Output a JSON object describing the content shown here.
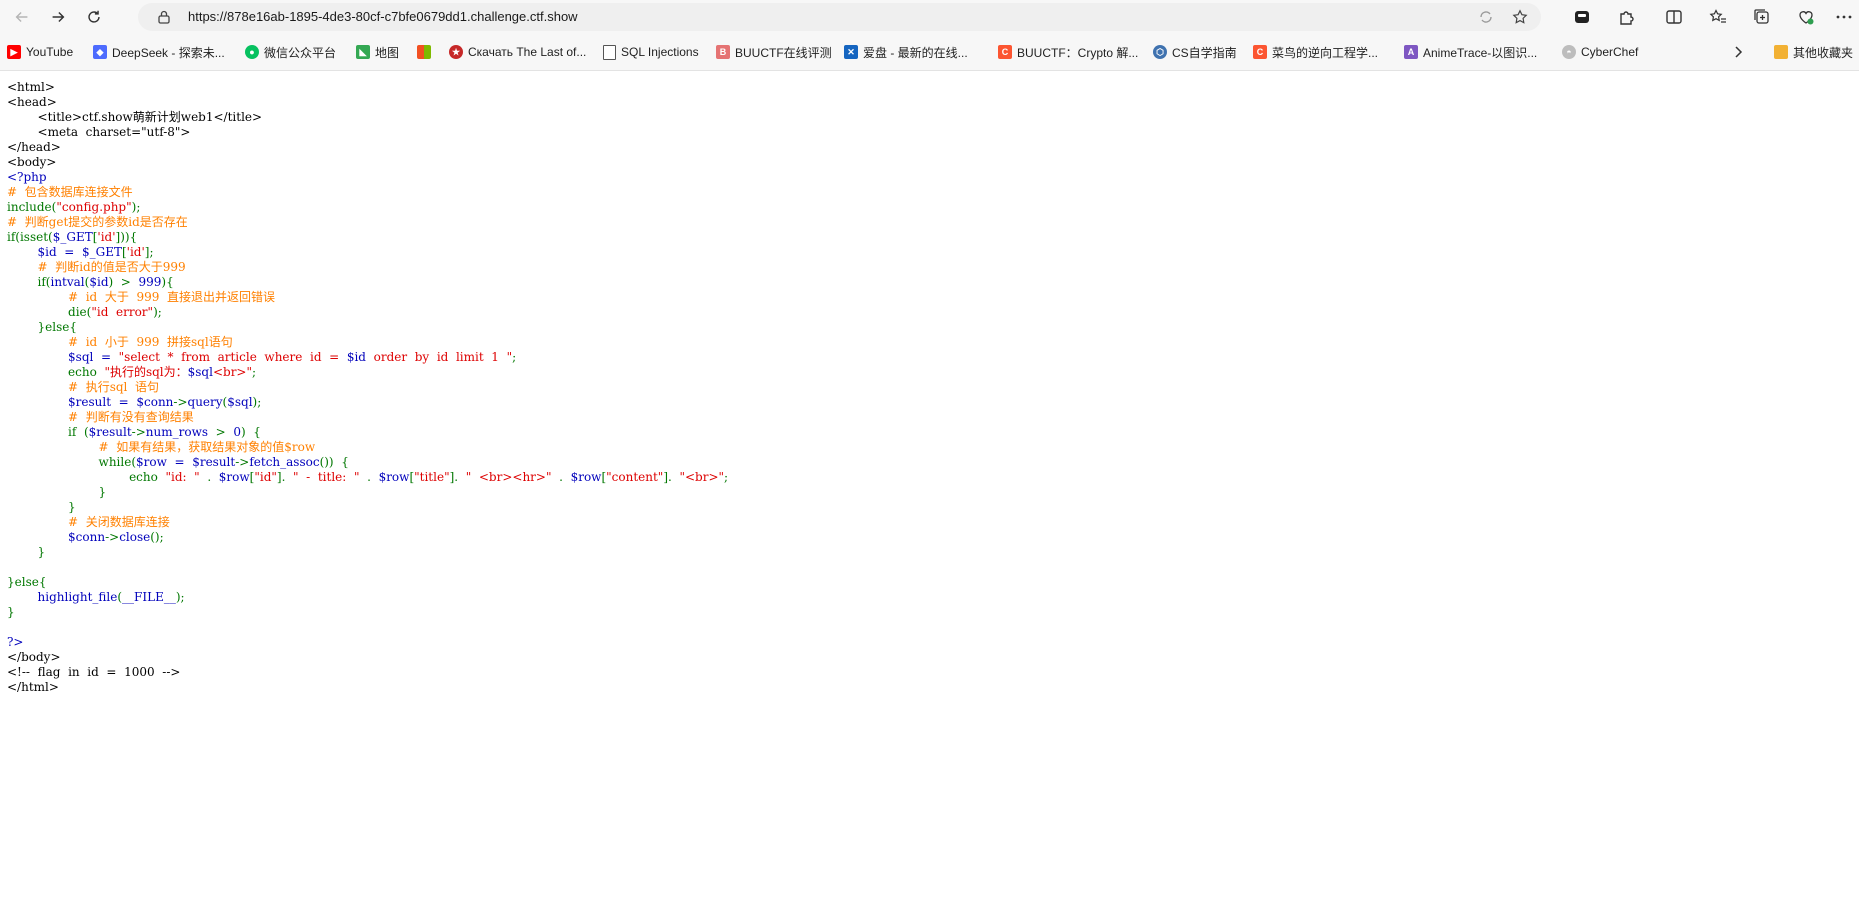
{
  "browser": {
    "url": "https://878e16ab-1895-4de3-80cf-c7bfe0679dd1.challenge.ctf.show",
    "bookmarks": [
      {
        "label": "YouTube",
        "icon": "youtube-icon",
        "color": "#ff0000"
      },
      {
        "label": "DeepSeek - 探索未...",
        "icon": "deepseek-icon",
        "color": "#4d6bfe"
      },
      {
        "label": "微信公众平台",
        "icon": "wechat-icon",
        "color": "#07c160"
      },
      {
        "label": "地图",
        "icon": "map-icon",
        "color": "#34a853"
      },
      {
        "label": "",
        "icon": "microsoft-icon",
        "color": "#f25022"
      },
      {
        "label": "Скачать The Last of...",
        "icon": "site-icon",
        "color": "#c62828"
      },
      {
        "label": "SQL Injections",
        "icon": "page-icon",
        "color": "#555555"
      },
      {
        "label": "BUUCTF在线评测",
        "icon": "buuctf-icon",
        "color": "#e57373"
      },
      {
        "label": "爱盘 - 最新的在线...",
        "icon": "aipan-icon",
        "color": "#1565c0"
      },
      {
        "label": "BUUCTF：Crypto 解...",
        "icon": "csdn-icon",
        "color": "#fc5531"
      },
      {
        "label": "CS自学指南",
        "icon": "cs-icon",
        "color": "#3f72af"
      },
      {
        "label": "菜鸟的逆向工程学...",
        "icon": "csdn-icon",
        "color": "#fc5531"
      },
      {
        "label": "AnimeTrace-以图识...",
        "icon": "animetrace-icon",
        "color": "#7e57c2"
      },
      {
        "label": "CyberChef",
        "icon": "cyberchef-icon",
        "color": "#9e9e9e"
      }
    ],
    "other_bookmarks_label": "其他收藏夹"
  },
  "source_lines": [
    [
      {
        "t": "<html>",
        "c": "html"
      }
    ],
    [
      {
        "t": "<head>",
        "c": "html"
      }
    ],
    [
      {
        "t": "        <title>ctf.show萌新计划web1</title>",
        "c": "html"
      }
    ],
    [
      {
        "t": "        <meta  charset=\"utf-8\">",
        "c": "html"
      }
    ],
    [
      {
        "t": "</head>",
        "c": "html"
      }
    ],
    [
      {
        "t": "<body>",
        "c": "html"
      }
    ],
    [
      {
        "t": "<?php",
        "c": "default"
      }
    ],
    [
      {
        "t": "#  包含数据库连接文件",
        "c": "comment"
      }
    ],
    [
      {
        "t": "include(",
        "c": "keyword"
      },
      {
        "t": "\"config.php\"",
        "c": "string"
      },
      {
        "t": ");",
        "c": "keyword"
      }
    ],
    [
      {
        "t": "#  判断get提交的参数id是否存在",
        "c": "comment"
      }
    ],
    [
      {
        "t": "if(isset(",
        "c": "keyword"
      },
      {
        "t": "$_GET",
        "c": "default"
      },
      {
        "t": "[",
        "c": "keyword"
      },
      {
        "t": "'id'",
        "c": "string"
      },
      {
        "t": "])){",
        "c": "keyword"
      }
    ],
    [
      {
        "t": "        ",
        "c": "keyword"
      },
      {
        "t": "$id  =  $_GET",
        "c": "default"
      },
      {
        "t": "[",
        "c": "keyword"
      },
      {
        "t": "'id'",
        "c": "string"
      },
      {
        "t": "];",
        "c": "keyword"
      }
    ],
    [
      {
        "t": "        #  判断id的值是否大于999",
        "c": "comment"
      }
    ],
    [
      {
        "t": "        if(",
        "c": "keyword"
      },
      {
        "t": "intval",
        "c": "default"
      },
      {
        "t": "(",
        "c": "keyword"
      },
      {
        "t": "$id",
        "c": "default"
      },
      {
        "t": ")  >  ",
        "c": "keyword"
      },
      {
        "t": "999",
        "c": "default"
      },
      {
        "t": "){",
        "c": "keyword"
      }
    ],
    [
      {
        "t": "                #  id  大于  999  直接退出并返回错误",
        "c": "comment"
      }
    ],
    [
      {
        "t": "                die(",
        "c": "keyword"
      },
      {
        "t": "\"id  error\"",
        "c": "string"
      },
      {
        "t": ");",
        "c": "keyword"
      }
    ],
    [
      {
        "t": "        }else{",
        "c": "keyword"
      }
    ],
    [
      {
        "t": "                #  id  小于  999  拼接sql语句",
        "c": "comment"
      }
    ],
    [
      {
        "t": "                ",
        "c": "keyword"
      },
      {
        "t": "$sql  =  ",
        "c": "default"
      },
      {
        "t": "\"select  *  from  article  where  id  =  ",
        "c": "string"
      },
      {
        "t": "$id",
        "c": "default"
      },
      {
        "t": "  order  by  id  limit  1  \"",
        "c": "string"
      },
      {
        "t": ";",
        "c": "keyword"
      }
    ],
    [
      {
        "t": "                echo  ",
        "c": "keyword"
      },
      {
        "t": "\"执行的sql为：",
        "c": "string"
      },
      {
        "t": "$sql",
        "c": "default"
      },
      {
        "t": "<br>\"",
        "c": "string"
      },
      {
        "t": ";",
        "c": "keyword"
      }
    ],
    [
      {
        "t": "                #  执行sql  语句",
        "c": "comment"
      }
    ],
    [
      {
        "t": "                ",
        "c": "keyword"
      },
      {
        "t": "$result  =  $conn",
        "c": "default"
      },
      {
        "t": "->",
        "c": "keyword"
      },
      {
        "t": "query",
        "c": "default"
      },
      {
        "t": "(",
        "c": "keyword"
      },
      {
        "t": "$sql",
        "c": "default"
      },
      {
        "t": ");",
        "c": "keyword"
      }
    ],
    [
      {
        "t": "                #  判断有没有查询结果",
        "c": "comment"
      }
    ],
    [
      {
        "t": "                if  (",
        "c": "keyword"
      },
      {
        "t": "$result",
        "c": "default"
      },
      {
        "t": "->",
        "c": "keyword"
      },
      {
        "t": "num_rows  ",
        "c": "default"
      },
      {
        "t": ">  ",
        "c": "keyword"
      },
      {
        "t": "0",
        "c": "default"
      },
      {
        "t": ")  {",
        "c": "keyword"
      }
    ],
    [
      {
        "t": "                        #  如果有结果，获取结果对象的值",
        "c": "comment"
      },
      {
        "t": "$row",
        "c": "comment"
      }
    ],
    [
      {
        "t": "                        while(",
        "c": "keyword"
      },
      {
        "t": "$row  =  $result",
        "c": "default"
      },
      {
        "t": "->",
        "c": "keyword"
      },
      {
        "t": "fetch_assoc",
        "c": "default"
      },
      {
        "t": "())  {",
        "c": "keyword"
      }
    ],
    [
      {
        "t": "                                echo  ",
        "c": "keyword"
      },
      {
        "t": "\"id:  \"  ",
        "c": "string"
      },
      {
        "t": ".  ",
        "c": "keyword"
      },
      {
        "t": "$row",
        "c": "default"
      },
      {
        "t": "[",
        "c": "keyword"
      },
      {
        "t": "\"id\"",
        "c": "string"
      },
      {
        "t": "].  ",
        "c": "keyword"
      },
      {
        "t": "\"  -  title:  \"  ",
        "c": "string"
      },
      {
        "t": ".  ",
        "c": "keyword"
      },
      {
        "t": "$row",
        "c": "default"
      },
      {
        "t": "[",
        "c": "keyword"
      },
      {
        "t": "\"title\"",
        "c": "string"
      },
      {
        "t": "].  ",
        "c": "keyword"
      },
      {
        "t": "\"  <br><hr>\"  ",
        "c": "string"
      },
      {
        "t": ".  ",
        "c": "keyword"
      },
      {
        "t": "$row",
        "c": "default"
      },
      {
        "t": "[",
        "c": "keyword"
      },
      {
        "t": "\"content\"",
        "c": "string"
      },
      {
        "t": "].  ",
        "c": "keyword"
      },
      {
        "t": "\"<br>\"",
        "c": "string"
      },
      {
        "t": ";",
        "c": "keyword"
      }
    ],
    [
      {
        "t": "                        }",
        "c": "keyword"
      }
    ],
    [
      {
        "t": "                }",
        "c": "keyword"
      }
    ],
    [
      {
        "t": "                #  关闭数据库连接",
        "c": "comment"
      }
    ],
    [
      {
        "t": "                ",
        "c": "keyword"
      },
      {
        "t": "$conn",
        "c": "default"
      },
      {
        "t": "->",
        "c": "keyword"
      },
      {
        "t": "close",
        "c": "default"
      },
      {
        "t": "();",
        "c": "keyword"
      }
    ],
    [
      {
        "t": "        }",
        "c": "keyword"
      }
    ],
    [
      {
        "t": "",
        "c": "keyword"
      }
    ],
    [
      {
        "t": "}else{",
        "c": "keyword"
      }
    ],
    [
      {
        "t": "        ",
        "c": "keyword"
      },
      {
        "t": "highlight_file",
        "c": "default"
      },
      {
        "t": "(",
        "c": "keyword"
      },
      {
        "t": "__FILE__",
        "c": "default"
      },
      {
        "t": ");",
        "c": "keyword"
      }
    ],
    [
      {
        "t": "}",
        "c": "keyword"
      }
    ],
    [
      {
        "t": "",
        "c": "keyword"
      }
    ],
    [
      {
        "t": "?>",
        "c": "default"
      }
    ],
    [
      {
        "t": "</body>",
        "c": "html"
      }
    ],
    [
      {
        "t": "<!--  flag  in  id  =  1000  -->",
        "c": "html"
      }
    ],
    [
      {
        "t": "</html>",
        "c": "html"
      }
    ]
  ]
}
